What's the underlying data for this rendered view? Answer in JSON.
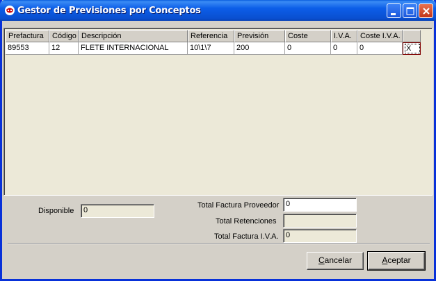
{
  "window": {
    "title": "Gestor de Previsiones por Conceptos"
  },
  "grid": {
    "columns": [
      {
        "label": "Prefactura",
        "width": 63
      },
      {
        "label": "Código",
        "width": 42
      },
      {
        "label": "Descripción",
        "width": 157
      },
      {
        "label": "Referencia",
        "width": 67
      },
      {
        "label": "Previsión",
        "width": 73
      },
      {
        "label": "Coste",
        "width": 66
      },
      {
        "label": "I.V.A.",
        "width": 38
      },
      {
        "label": "Coste I.V.A.",
        "width": 65
      },
      {
        "label": "",
        "width": 26
      }
    ],
    "rows": [
      [
        "89553",
        "12",
        "FLETE INTERNACIONAL",
        "10\\1\\7",
        "200",
        "0",
        "0",
        "0",
        "X"
      ]
    ]
  },
  "form": {
    "disponible_label": "Disponible",
    "disponible_value": "0",
    "total_factura_proveedor_label": "Total Factura Proveedor",
    "total_factura_proveedor_value": "0",
    "total_retenciones_label": "Total Retenciones",
    "total_retenciones_value": "",
    "total_factura_iva_label": "Total Factura I.V.A.",
    "total_factura_iva_value": "0"
  },
  "buttons": {
    "cancelar_mnemonic": "C",
    "cancelar_rest": "ancelar",
    "aceptar_mnemonic": "A",
    "aceptar_rest": "ceptar"
  },
  "colors": {
    "titlebar": "#0a5fde",
    "close_button": "#c1341a",
    "dialog_bg": "#d4d0c8",
    "grid_bg": "#ece9d8"
  }
}
